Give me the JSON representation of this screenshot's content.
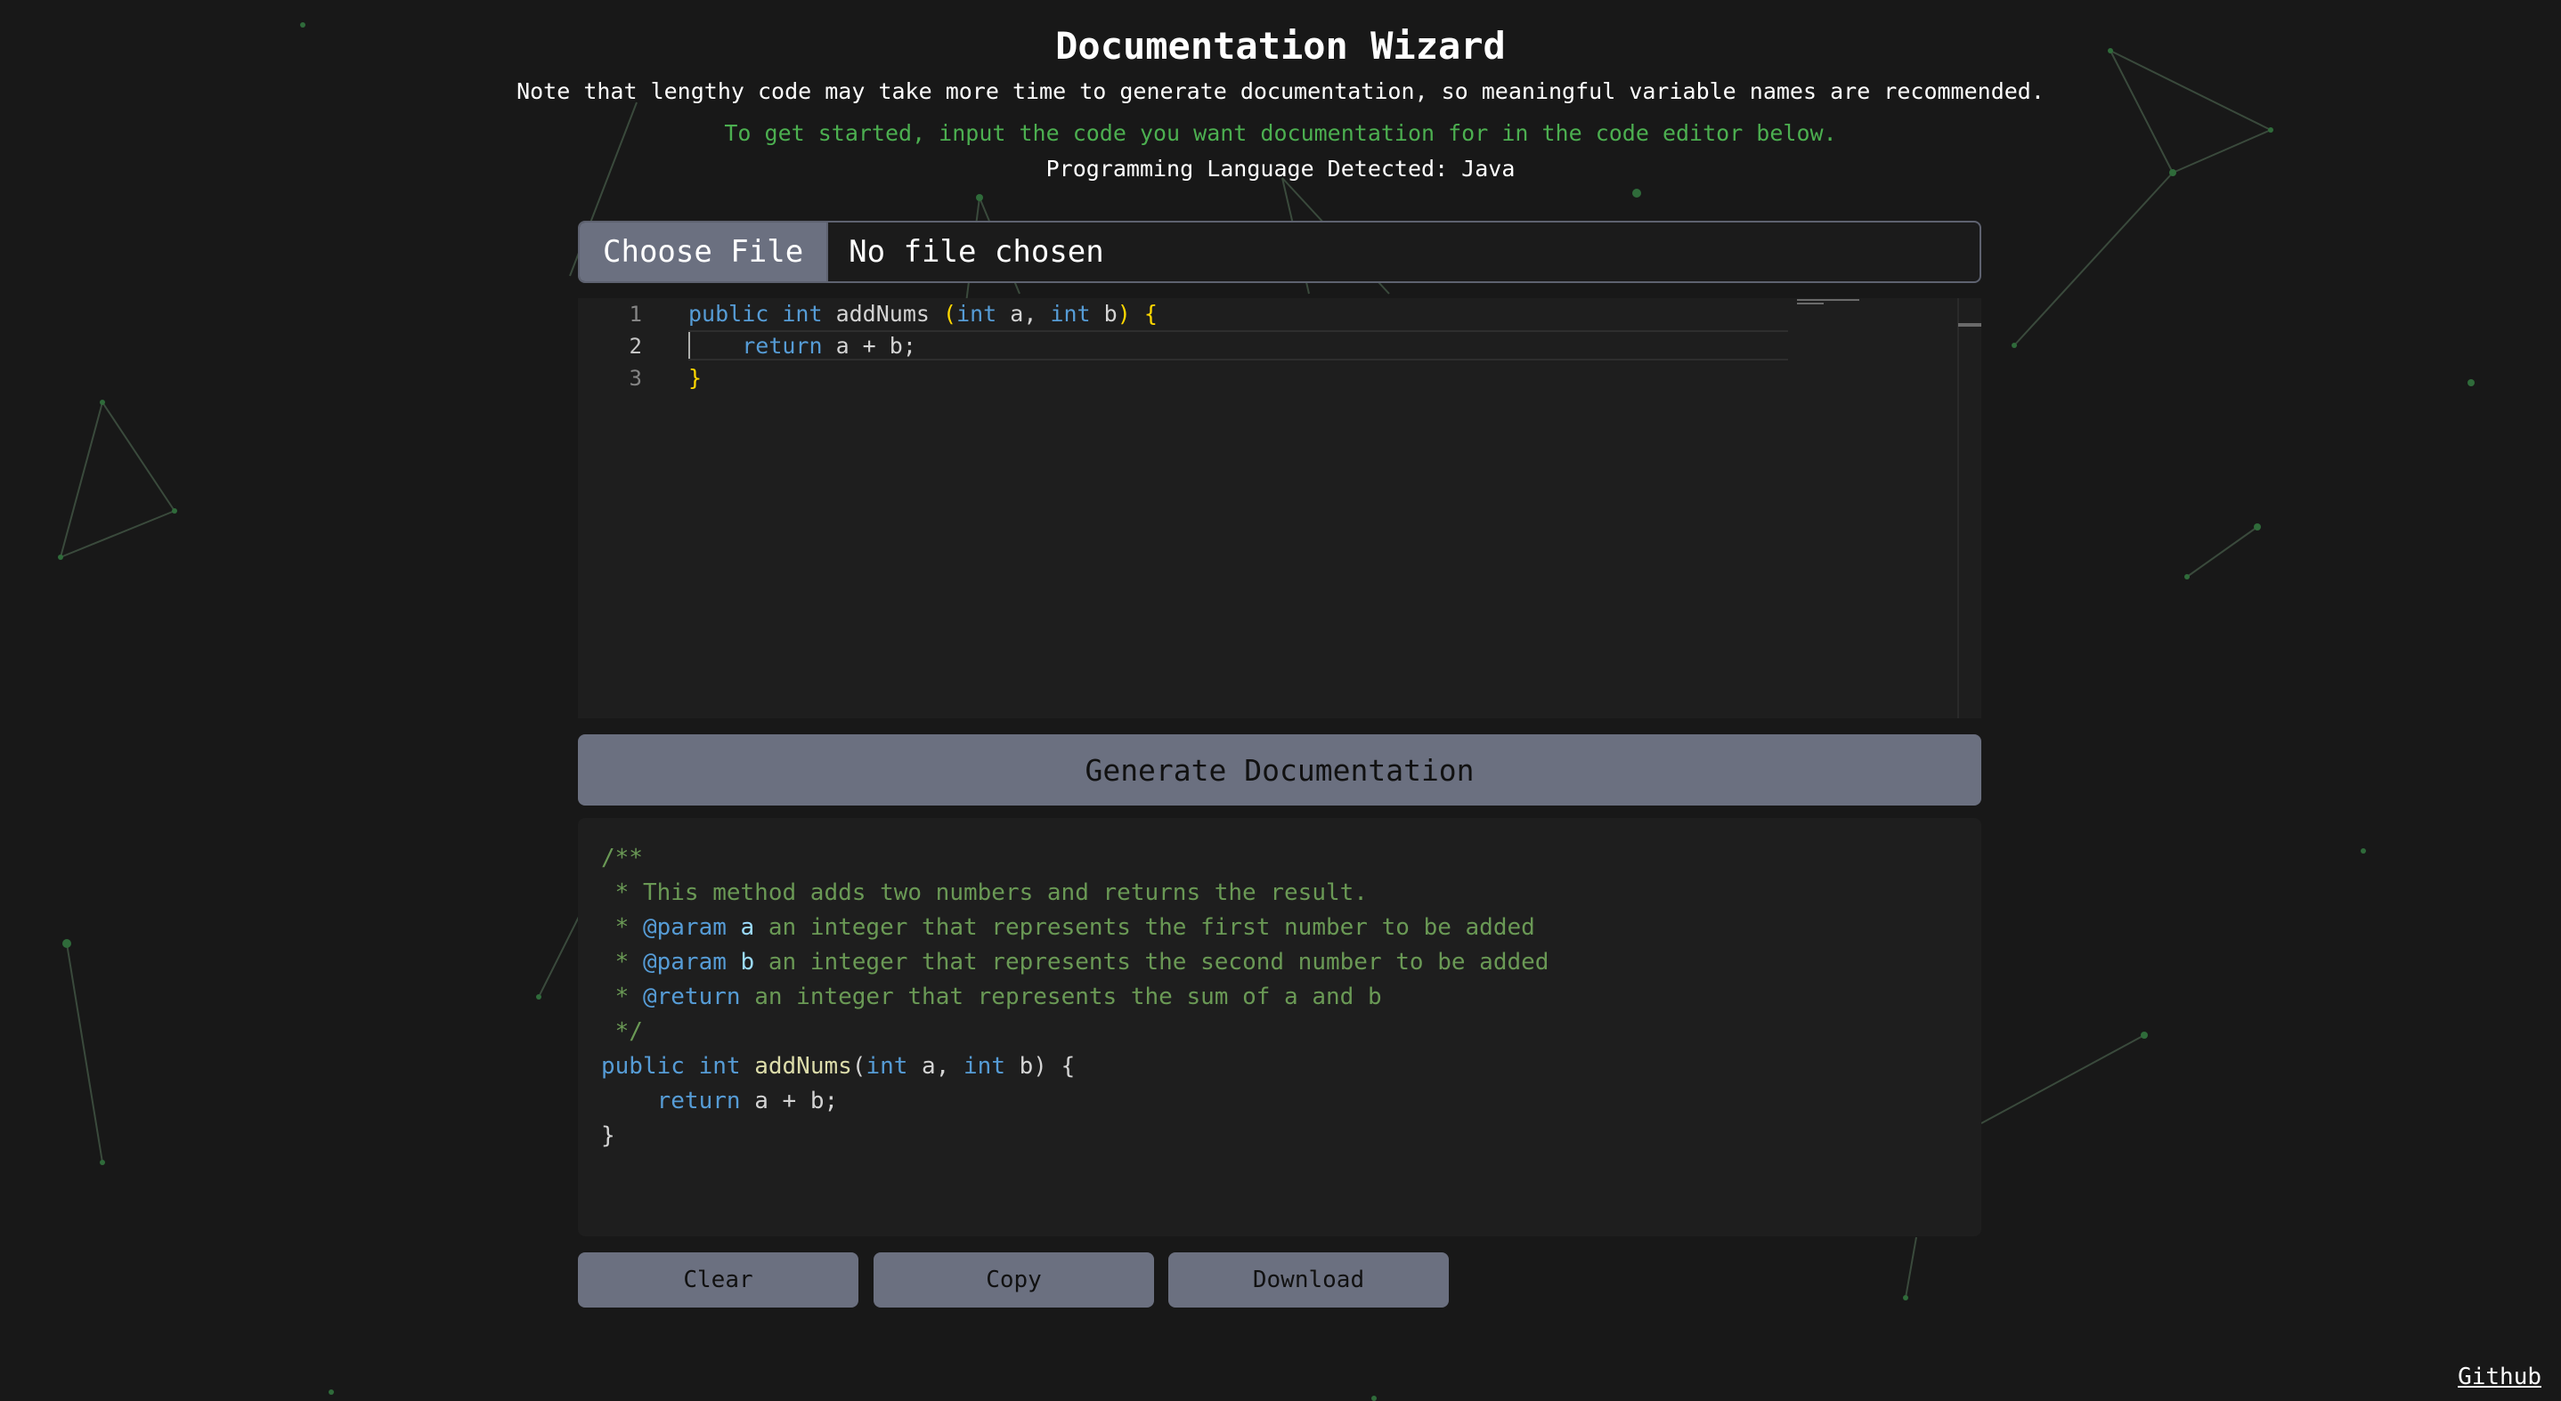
{
  "header": {
    "title": "Documentation Wizard",
    "note": "Note that lengthy code may take more time to generate documentation, so meaningful variable names are recommended.",
    "hint": "To get started, input the code you want documentation for in the code editor below.",
    "detected_language": "Programming Language Detected: Java"
  },
  "file_picker": {
    "button_label": "Choose File",
    "status": "No file chosen"
  },
  "editor": {
    "line_numbers": [
      "1",
      "2",
      "3"
    ],
    "lines": [
      [
        "public",
        " ",
        "int",
        " addNums ",
        "(",
        "int",
        " a, ",
        "int",
        " b",
        ")",
        " ",
        "{"
      ],
      [
        "    ",
        "return",
        " a + b;"
      ],
      [
        "}"
      ]
    ],
    "active_line": "2"
  },
  "generate_button": "Generate Documentation",
  "output": {
    "lines": [
      "/**",
      " * This method adds two numbers and returns the result.",
      " * @param a an integer that represents the first number to be added",
      " * @param b an integer that represents the second number to be added",
      " * @return an integer that represents the sum of a and b",
      " */",
      "public int addNums(int a, int b) {",
      "    return a + b;",
      "}"
    ]
  },
  "actions": {
    "clear": "Clear",
    "copy": "Copy",
    "download": "Download"
  },
  "footer": {
    "github": "Github"
  },
  "colors": {
    "background": "#181818",
    "accent_green": "#4caf50",
    "button_gray": "#6b7080",
    "editor_bg": "#1e1e1e",
    "keyword_blue": "#569cd6",
    "comment_green": "#6a9955",
    "brace_yellow": "#ffd700"
  }
}
